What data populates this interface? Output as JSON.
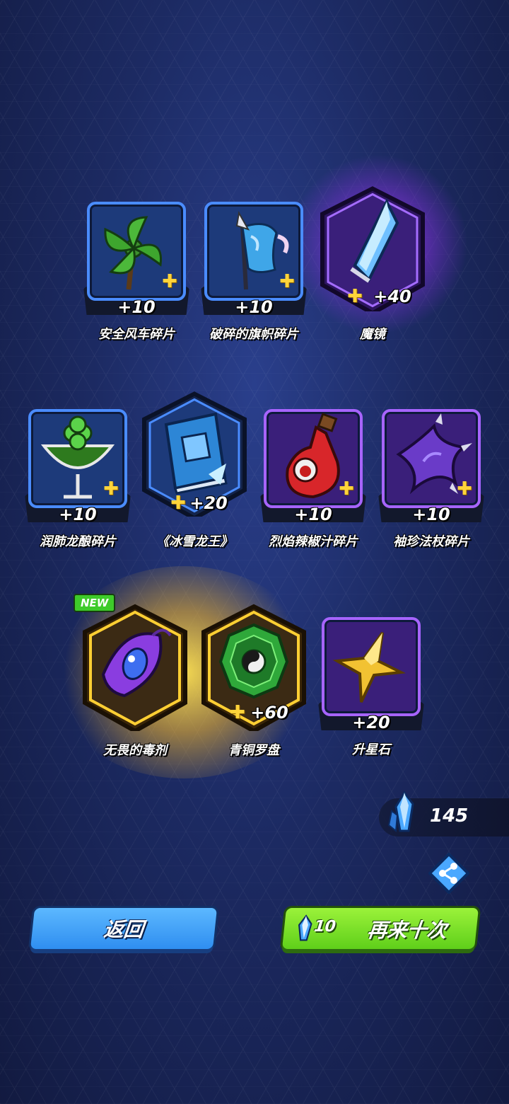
{
  "colors": {
    "rare_border": "#4a8cff",
    "epic_border": "#a764ff",
    "legend_glow": "#ffd23a",
    "back_button": "#3a9af5",
    "again_button": "#7de02a"
  },
  "rows": [
    [
      {
        "name": "安全风车碎片",
        "count": "+10",
        "icon": "windmill-icon",
        "frame": "rare",
        "fragment": true
      },
      {
        "name": "破碎的旗帜碎片",
        "count": "+10",
        "icon": "banner-icon",
        "frame": "rare",
        "fragment": true
      },
      {
        "name": "魔镜",
        "count": "+40",
        "icon": "mirror-crystal-icon",
        "frame": "hex-epic",
        "fragment": true
      }
    ],
    [
      {
        "name": "润肺龙酿碎片",
        "count": "+10",
        "icon": "clover-cocktail-icon",
        "frame": "rare",
        "fragment": true
      },
      {
        "name": "《冰雪龙王》",
        "count": "+20",
        "icon": "ice-book-icon",
        "frame": "hex-rare",
        "fragment": true
      },
      {
        "name": "烈焰辣椒汁碎片",
        "count": "+10",
        "icon": "chili-potion-icon",
        "frame": "epic",
        "fragment": true
      },
      {
        "name": "袖珍法杖碎片",
        "count": "+10",
        "icon": "thorn-staff-icon",
        "frame": "epic",
        "fragment": true
      }
    ],
    [
      {
        "name": "无畏的毒剂",
        "count": "",
        "icon": "purple-eye-gem-icon",
        "frame": "hex-legend",
        "fragment": false,
        "badge": "NEW"
      },
      {
        "name": "青铜罗盘",
        "count": "+60",
        "icon": "bagua-compass-icon",
        "frame": "hex-legend",
        "fragment": true
      },
      {
        "name": "升星石",
        "count": "+20",
        "icon": "gold-star-icon",
        "frame": "epic",
        "fragment": false
      }
    ]
  ],
  "currency": {
    "value": "145",
    "icon": "blue-crystal-icon"
  },
  "share_icon": "share-icon",
  "buttons": {
    "back_label": "返回",
    "again_label": "再来十次",
    "again_cost": "10"
  }
}
